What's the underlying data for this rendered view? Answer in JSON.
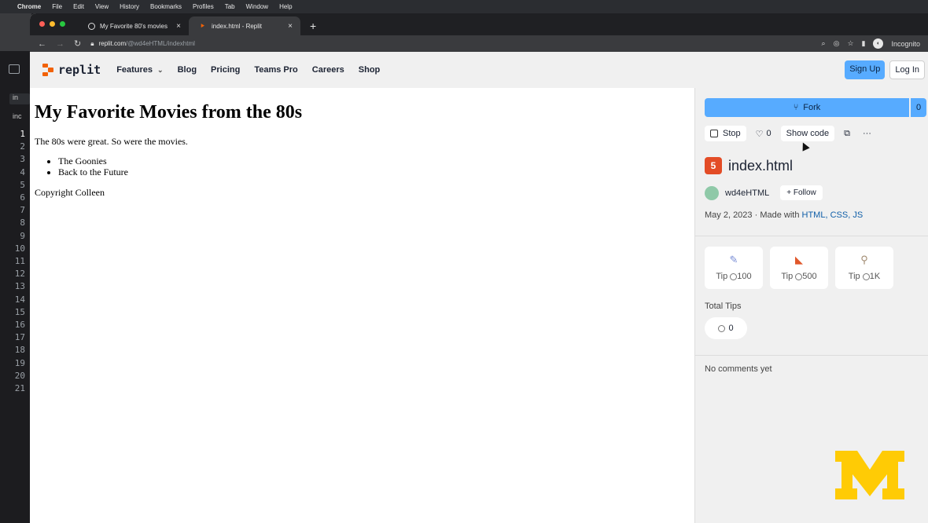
{
  "mac_menu": {
    "app": "Chrome",
    "items": [
      "File",
      "Edit",
      "View",
      "History",
      "Bookmarks",
      "Profiles",
      "Tab",
      "Window",
      "Help"
    ]
  },
  "editor": {
    "file_chips": [
      "in",
      "inc"
    ],
    "line_numbers": [
      "1",
      "2",
      "3",
      "4",
      "5",
      "6",
      "7",
      "8",
      "9",
      "10",
      "11",
      "12",
      "13",
      "14",
      "15",
      "16",
      "17",
      "18",
      "19",
      "20",
      "21"
    ]
  },
  "browser": {
    "tabs": [
      {
        "title": "My Favorite 80's movies",
        "close": "×"
      },
      {
        "title": "index.html - Replit",
        "close": "×"
      }
    ],
    "new_tab": "+",
    "url_host": "replit.com",
    "url_path": "/@wd4eHTML/indexhtml",
    "profile_label": "Incognito"
  },
  "site": {
    "logo_text": "replit",
    "nav": [
      "Features",
      "Blog",
      "Pricing",
      "Teams Pro",
      "Careers",
      "Shop"
    ],
    "sign_up": "Sign Up",
    "log_in": "Log In"
  },
  "page": {
    "heading": "My Favorite Movies from the 80s",
    "intro": "The 80s were great. So were the movies.",
    "movies": [
      "The Goonies",
      "Back to the Future"
    ],
    "footer": "Copyright Colleen"
  },
  "panel": {
    "fork_label": "Fork",
    "fork_count": "0",
    "stop_label": "Stop",
    "likes": "0",
    "show_code": "Show code",
    "more": "···",
    "file_title": "index.html",
    "owner": "wd4eHTML",
    "follow": "Follow",
    "date_text": "May 2, 2023 · Made with",
    "tech": [
      "HTML",
      "CSS",
      "JS"
    ],
    "tips": [
      {
        "label": "Tip",
        "amount": "100"
      },
      {
        "label": "Tip",
        "amount": "500"
      },
      {
        "label": "Tip",
        "amount": "1K"
      }
    ],
    "total_tips_label": "Total Tips",
    "total_tips_value": "0",
    "comments": "No comments yet"
  },
  "colors": {
    "accent": "#57abff",
    "brand_orange": "#f26207",
    "umich_maize": "#ffcb05"
  }
}
